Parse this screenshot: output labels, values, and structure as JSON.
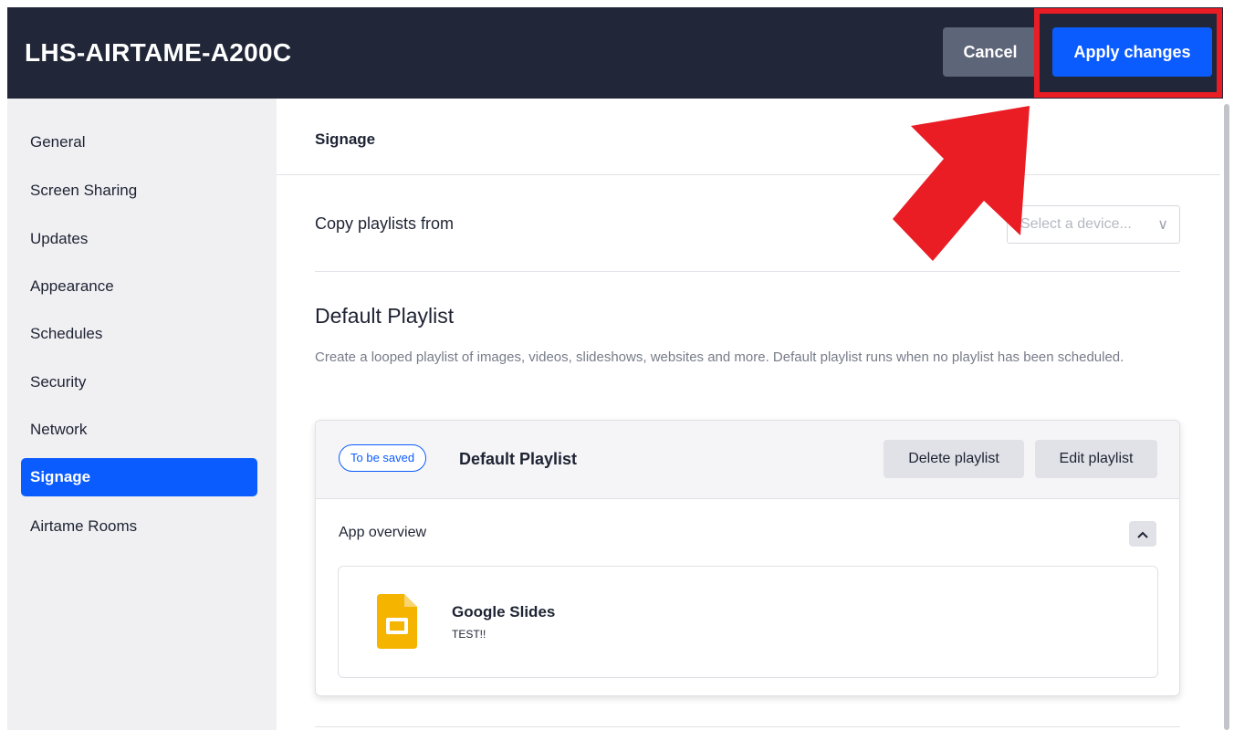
{
  "header": {
    "title": "LHS-AIRTAME-A200C",
    "cancel_label": "Cancel",
    "apply_label": "Apply changes"
  },
  "sidebar": {
    "items": [
      {
        "label": "General"
      },
      {
        "label": "Screen Sharing"
      },
      {
        "label": "Updates"
      },
      {
        "label": "Appearance"
      },
      {
        "label": "Schedules"
      },
      {
        "label": "Security"
      },
      {
        "label": "Network"
      },
      {
        "label": "Signage",
        "active": true
      },
      {
        "label": "Airtame Rooms"
      }
    ]
  },
  "main": {
    "section_title": "Signage",
    "copy_label": "Copy playlists from",
    "device_select_placeholder": "Select a device...",
    "playlist_heading": "Default Playlist",
    "playlist_description": "Create a looped playlist of images, videos, slideshows, websites and more. Default playlist runs when no playlist has been scheduled.",
    "playlist_card": {
      "badge": "To be saved",
      "title": "Default Playlist",
      "delete_label": "Delete playlist",
      "edit_label": "Edit playlist",
      "app_overview_label": "App overview",
      "apps": [
        {
          "name": "Google Slides",
          "subtitle": "TEST!!",
          "icon": "google-slides-icon"
        }
      ]
    }
  },
  "colors": {
    "header_bg": "#212738",
    "accent": "#0b5cff",
    "highlight": "#ea1c24",
    "sidebar_bg": "#f0f0f3",
    "slides_yellow": "#f4b400"
  }
}
